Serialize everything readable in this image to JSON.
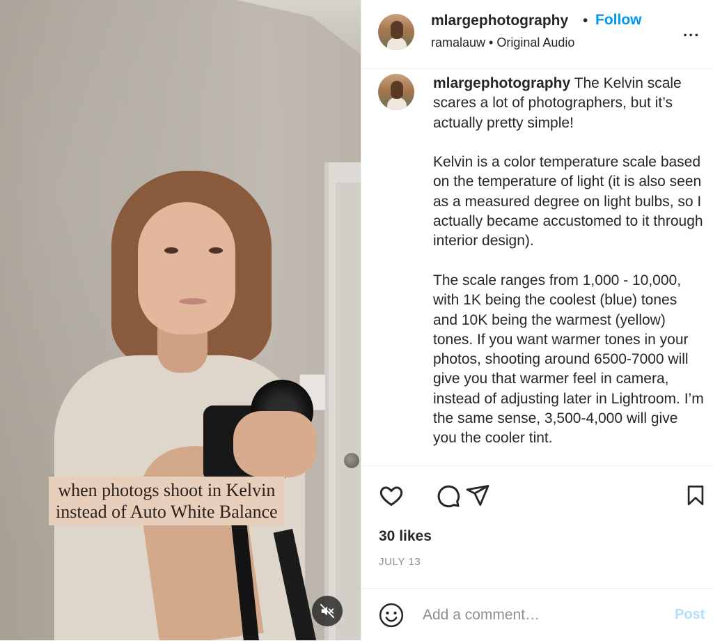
{
  "media": {
    "overlay_caption_line1": "when photogs shoot in Kelvin",
    "overlay_caption_line2": "instead of Auto White Balance",
    "mute_icon": "speaker-muted-icon"
  },
  "header": {
    "username": "mlargephotography",
    "separator": "•",
    "follow_label": "Follow",
    "audio_line": "ramalauw • Original Audio",
    "more_label": "..."
  },
  "caption": {
    "username": "mlargephotography",
    "intro": "The Kelvin scale scares a lot of photographers, but it’s actually pretty simple!",
    "paragraph2": "Kelvin is a color temperature scale based on the temperature of light (it is also seen as a measured degree on light bulbs, so I actually became accustomed to it through interior design).",
    "paragraph3": "The scale ranges from 1,000 - 10,000, with 1K being the coolest (blue) tones and 10K being the warmest (yellow) tones. If you want warmer tones in your photos, shooting around 6500-7000 will give you that warmer feel in camera, instead of adjusting later in Lightroom. I’m the same sense, 3,500-4,000 will give you the cooler tint."
  },
  "actions": {
    "icons": [
      "heart-icon",
      "comment-icon",
      "share-icon",
      "bookmark-icon"
    ],
    "likes": "30 likes",
    "date": "JULY 13"
  },
  "comment": {
    "placeholder": "Add a comment…",
    "post_label": "Post",
    "emoji_icon": "emoji-icon"
  },
  "colors": {
    "follow": "#0095f6",
    "post_disabled": "#b2dffc",
    "text": "#262626",
    "muted": "#8e8e8e",
    "caption_bg": "#e7cfbb"
  }
}
